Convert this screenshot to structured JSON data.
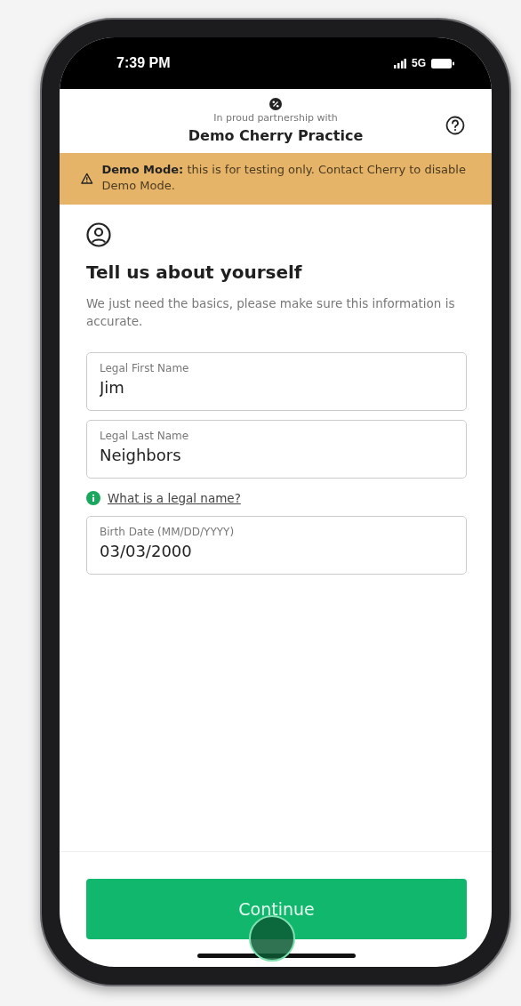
{
  "status_bar": {
    "time": "7:39 PM",
    "network": "5G"
  },
  "header": {
    "partnership_note": "In proud partnership with",
    "practice_name": "Demo Cherry Practice"
  },
  "banner": {
    "text": "**Demo Mode:** this is for testing only. Contact Cherry to disable Demo Mode."
  },
  "form": {
    "title": "Tell us about yourself",
    "subtitle": "We just need the basics, please make sure this information is accurate.",
    "fields": [
      {
        "label": "Legal First Name",
        "value": "Jim"
      },
      {
        "label": "Legal Last Name",
        "value": "Neighbors"
      },
      {
        "label": "Birth Date (MM/DD/YYYY)",
        "value": "03/03/2000"
      }
    ],
    "help_link": "What is a legal name?"
  },
  "continue_button": {
    "label": "Continue"
  }
}
